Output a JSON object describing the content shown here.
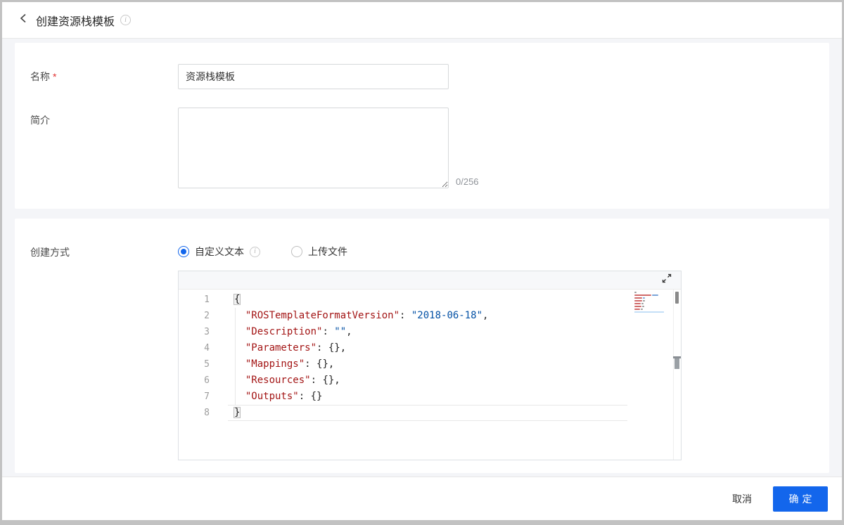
{
  "header": {
    "title": "创建资源栈模板"
  },
  "form": {
    "name_label": "名称",
    "required_mark": "*",
    "name_value": "资源栈模板",
    "desc_label": "简介",
    "desc_value": "",
    "desc_counter": "0/256",
    "method_label": "创建方式",
    "radio_custom_text": "自定义文本",
    "radio_upload_file": "上传文件"
  },
  "editor": {
    "language": "json",
    "lines": [
      {
        "num": "1",
        "tokens": [
          {
            "text": "{",
            "type": "brace"
          }
        ]
      },
      {
        "num": "2",
        "tokens": [
          {
            "text": "  ",
            "type": "ws"
          },
          {
            "text": "\"ROSTemplateFormatVersion\"",
            "type": "key"
          },
          {
            "text": ": ",
            "type": "punct"
          },
          {
            "text": "\"2018-06-18\"",
            "type": "str"
          },
          {
            "text": ",",
            "type": "punct"
          }
        ]
      },
      {
        "num": "3",
        "tokens": [
          {
            "text": "  ",
            "type": "ws"
          },
          {
            "text": "\"Description\"",
            "type": "key"
          },
          {
            "text": ": ",
            "type": "punct"
          },
          {
            "text": "\"\"",
            "type": "str"
          },
          {
            "text": ",",
            "type": "punct"
          }
        ]
      },
      {
        "num": "4",
        "tokens": [
          {
            "text": "  ",
            "type": "ws"
          },
          {
            "text": "\"Parameters\"",
            "type": "key"
          },
          {
            "text": ": ",
            "type": "punct"
          },
          {
            "text": "{},",
            "type": "punct"
          }
        ]
      },
      {
        "num": "5",
        "tokens": [
          {
            "text": "  ",
            "type": "ws"
          },
          {
            "text": "\"Mappings\"",
            "type": "key"
          },
          {
            "text": ": ",
            "type": "punct"
          },
          {
            "text": "{},",
            "type": "punct"
          }
        ]
      },
      {
        "num": "6",
        "tokens": [
          {
            "text": "  ",
            "type": "ws"
          },
          {
            "text": "\"Resources\"",
            "type": "key"
          },
          {
            "text": ": ",
            "type": "punct"
          },
          {
            "text": "{},",
            "type": "punct"
          }
        ]
      },
      {
        "num": "7",
        "tokens": [
          {
            "text": "  ",
            "type": "ws"
          },
          {
            "text": "\"Outputs\"",
            "type": "key"
          },
          {
            "text": ": ",
            "type": "punct"
          },
          {
            "text": "{}",
            "type": "punct"
          }
        ]
      },
      {
        "num": "8",
        "tokens": [
          {
            "text": "}",
            "type": "brace"
          }
        ],
        "current": true
      }
    ],
    "minimap_rows": [
      {
        "segments": [
          [
            3,
            "dark"
          ]
        ]
      },
      {
        "segments": [
          [
            24,
            "red"
          ],
          [
            9,
            "blue"
          ]
        ]
      },
      {
        "segments": [
          [
            11,
            "red"
          ],
          [
            3,
            "blue"
          ]
        ]
      },
      {
        "segments": [
          [
            11,
            "red"
          ],
          [
            3,
            "dark"
          ]
        ]
      },
      {
        "segments": [
          [
            9,
            "red"
          ],
          [
            3,
            "dark"
          ]
        ]
      },
      {
        "segments": [
          [
            10,
            "red"
          ],
          [
            3,
            "dark"
          ]
        ]
      },
      {
        "segments": [
          [
            8,
            "red"
          ],
          [
            3,
            "dark"
          ]
        ]
      }
    ]
  },
  "footer": {
    "cancel_label": "取消",
    "confirm_label": "确定"
  },
  "colors": {
    "accent_blue": "#1366ec",
    "code_key": "#a31515",
    "code_string": "#0451a5",
    "required_red": "#e02f2f",
    "minimap_red": "#d06a6a",
    "minimap_blue": "#7aa5d8",
    "minimap_dark": "#9a9a9a"
  }
}
